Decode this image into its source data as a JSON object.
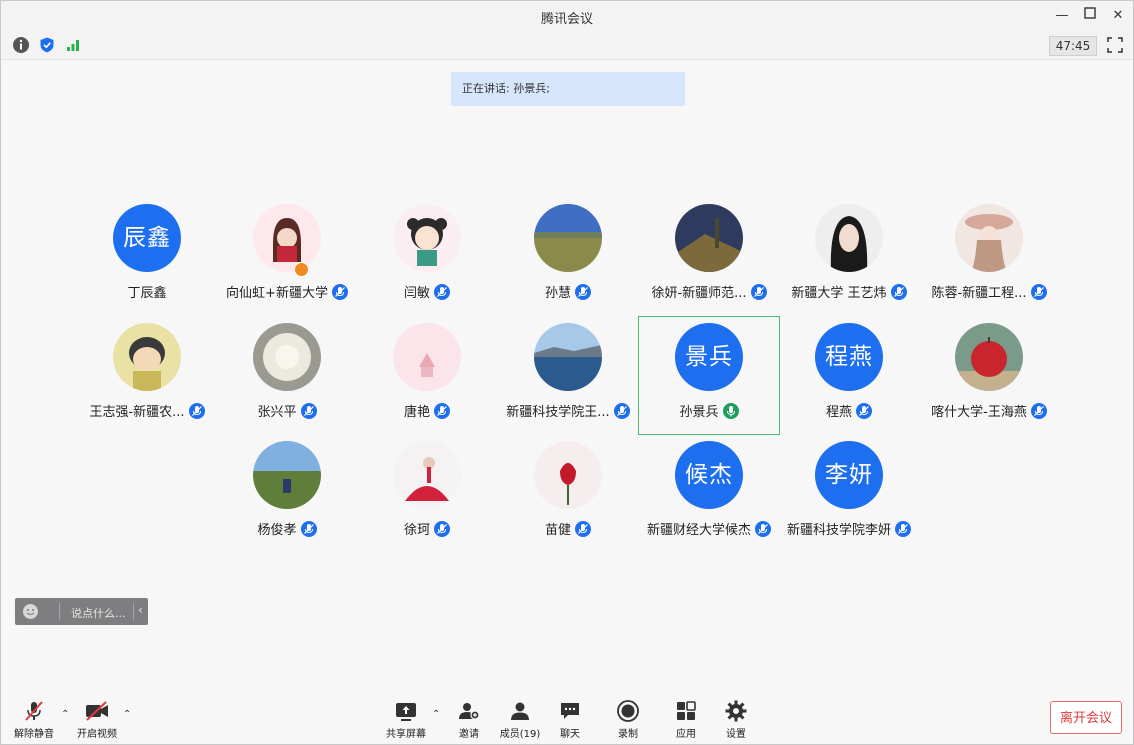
{
  "window": {
    "title": "腾讯会议"
  },
  "status": {
    "timer": "47:45"
  },
  "speaking": "正在讲话: 孙景兵;",
  "participants": [
    {
      "name": "丁辰鑫",
      "avatar_text": "辰鑫",
      "mic": false
    },
    {
      "name": "向仙虹+新疆大学",
      "avatar_text": "",
      "mic": true,
      "host": true
    },
    {
      "name": "闫敏",
      "avatar_text": "",
      "mic": true
    },
    {
      "name": "孙慧",
      "avatar_text": "",
      "mic": true
    },
    {
      "name": "徐妍-新疆师范...",
      "avatar_text": "",
      "mic": true
    },
    {
      "name": "新疆大学 王艺炜",
      "avatar_text": "",
      "mic": true
    },
    {
      "name": "陈蓉-新疆工程...",
      "avatar_text": "",
      "mic": true
    },
    {
      "name": "王志强-新疆农...",
      "avatar_text": "",
      "mic": true
    },
    {
      "name": "张兴平",
      "avatar_text": "",
      "mic": true
    },
    {
      "name": "唐艳",
      "avatar_text": "",
      "mic": true
    },
    {
      "name": "新疆科技学院王...",
      "avatar_text": "",
      "mic": true
    },
    {
      "name": "孙景兵",
      "avatar_text": "景兵",
      "mic": true,
      "speaking": true
    },
    {
      "name": "程燕",
      "avatar_text": "程燕",
      "mic": true
    },
    {
      "name": "喀什大学-王海燕",
      "avatar_text": "",
      "mic": true
    },
    {
      "name": "杨俊孝",
      "avatar_text": "",
      "mic": true
    },
    {
      "name": "徐珂",
      "avatar_text": "",
      "mic": true
    },
    {
      "name": "苗健",
      "avatar_text": "",
      "mic": true
    },
    {
      "name": "新疆财经大学候杰",
      "avatar_text": "候杰",
      "mic": true
    },
    {
      "name": "新疆科技学院李妍",
      "avatar_text": "李妍",
      "mic": true
    }
  ],
  "chat": {
    "placeholder": "说点什么..."
  },
  "toolbar": {
    "unmute": "解除静音",
    "start_video": "开启视频",
    "share_screen": "共享屏幕",
    "invite": "邀请",
    "members": "成员(19)",
    "chat": "聊天",
    "record": "录制",
    "apps": "应用",
    "settings": "设置",
    "leave": "离开会议"
  },
  "colors": {
    "accent": "#1e6ff0",
    "active_border": "#4cba6a",
    "leave": "#d93c3c"
  }
}
